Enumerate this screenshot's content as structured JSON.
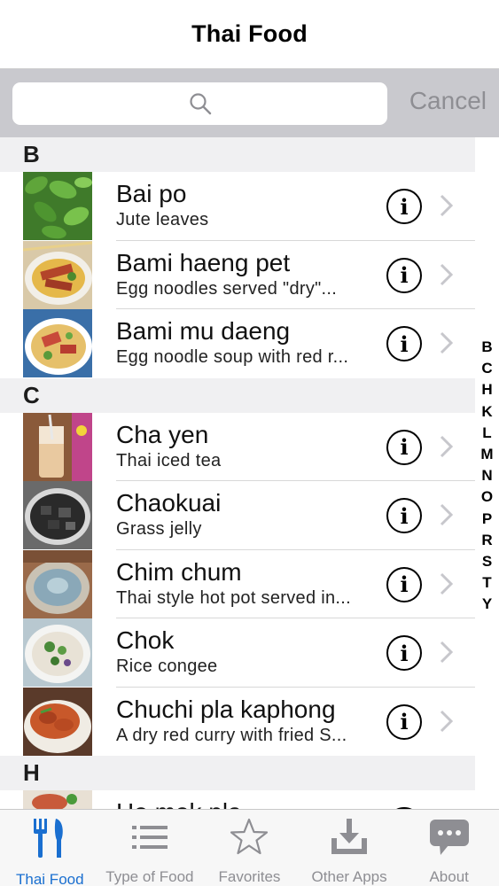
{
  "nav": {
    "title": "Thai Food"
  },
  "search": {
    "placeholder": "",
    "cancel_label": "Cancel"
  },
  "sections": [
    {
      "letter": "B",
      "items": [
        {
          "title": "Bai po",
          "subtitle": "Jute leaves",
          "thumb_icon": "jute-leaves-photo"
        },
        {
          "title": "Bami haeng pet",
          "subtitle": "Egg noodles served \"dry\"...",
          "thumb_icon": "duck-noodles-photo"
        },
        {
          "title": "Bami mu daeng",
          "subtitle": "Egg noodle soup with red r...",
          "thumb_icon": "noodle-soup-photo"
        }
      ]
    },
    {
      "letter": "C",
      "items": [
        {
          "title": "Cha yen",
          "subtitle": "Thai iced tea",
          "thumb_icon": "iced-tea-photo"
        },
        {
          "title": "Chaokuai",
          "subtitle": "Grass jelly",
          "thumb_icon": "grass-jelly-photo"
        },
        {
          "title": "Chim chum",
          "subtitle": "Thai style hot pot served in...",
          "thumb_icon": "hot-pot-photo"
        },
        {
          "title": "Chok",
          "subtitle": "Rice congee",
          "thumb_icon": "congee-photo"
        },
        {
          "title": "Chuchi pla kaphong",
          "subtitle": "A dry red curry with fried S...",
          "thumb_icon": "red-curry-photo"
        }
      ]
    },
    {
      "letter": "H",
      "items": [
        {
          "title": "Ho mok pla",
          "subtitle": "",
          "thumb_icon": "ho-mok-photo"
        }
      ]
    }
  ],
  "index_letters": [
    "B",
    "C",
    "H",
    "K",
    "L",
    "M",
    "N",
    "O",
    "P",
    "R",
    "S",
    "T",
    "Y"
  ],
  "tabs": [
    {
      "label": "Thai Food",
      "icon": "fork-knife-icon",
      "active": true
    },
    {
      "label": "Type of Food",
      "icon": "list-icon",
      "active": false
    },
    {
      "label": "Favorites",
      "icon": "star-icon",
      "active": false
    },
    {
      "label": "Other Apps",
      "icon": "download-tray-icon",
      "active": false
    },
    {
      "label": "About",
      "icon": "speech-bubble-icon",
      "active": false
    }
  ],
  "colors": {
    "accent": "#1a6fd0",
    "inactive": "#8e8e93",
    "search_bg": "#c9c9ce"
  }
}
